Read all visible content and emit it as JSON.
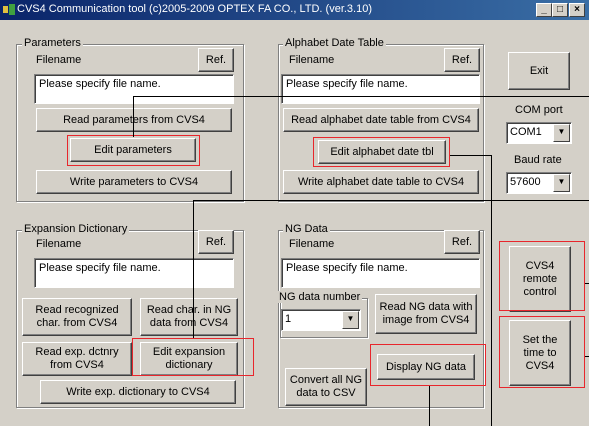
{
  "window": {
    "title": "CVS4 Communication tool (c)2005-2009 OPTEX FA CO., LTD. (ver.3.10)",
    "minimize_glyph": "_",
    "maximize_glyph": "□",
    "close_glyph": "×"
  },
  "parameters": {
    "legend": "Parameters",
    "filename_label": "Filename",
    "ref_label": "Ref.",
    "filename_value": "Please specify file name.",
    "read_label": "Read parameters from CVS4",
    "edit_label": "Edit parameters",
    "write_label": "Write parameters to CVS4"
  },
  "alphabet": {
    "legend": "Alphabet Date Table",
    "filename_label": "Filename",
    "ref_label": "Ref.",
    "filename_value": "Please specify file name.",
    "read_label": "Read alphabet date table from CVS4",
    "edit_label": "Edit alphabet date tbl",
    "write_label": "Write alphabet date table to CVS4"
  },
  "side": {
    "exit_label": "Exit",
    "com_port_label": "COM port",
    "com_port_value": "COM1",
    "baud_rate_label": "Baud rate",
    "baud_rate_value": "57600",
    "remote_label": "CVS4 remote control",
    "set_time_label": "Set the time to CVS4"
  },
  "expansion": {
    "legend": "Expansion Dictionary",
    "filename_label": "Filename",
    "ref_label": "Ref.",
    "filename_value": "Please specify file name.",
    "read_recognized_label": "Read recognized char. from CVS4",
    "read_ng_char_label": "Read char. in NG data from CVS4",
    "read_dict_label": "Read exp. dctnry from CVS4",
    "edit_label": "Edit expansion dictionary",
    "write_label": "Write exp. dictionary to CVS4"
  },
  "ng_data": {
    "legend": "NG Data",
    "filename_label": "Filename",
    "ref_label": "Ref.",
    "filename_value": "Please specify file name.",
    "number_legend": "NG data number",
    "number_value": "1",
    "read_image_label": "Read NG data with image from CVS4",
    "convert_label": "Convert all NG data to CSV",
    "display_label": "Display NG data"
  },
  "colors": {
    "titlebar": "#0a246a",
    "face": "#d4d0c8",
    "highlight_annotation": "#e8262c"
  }
}
